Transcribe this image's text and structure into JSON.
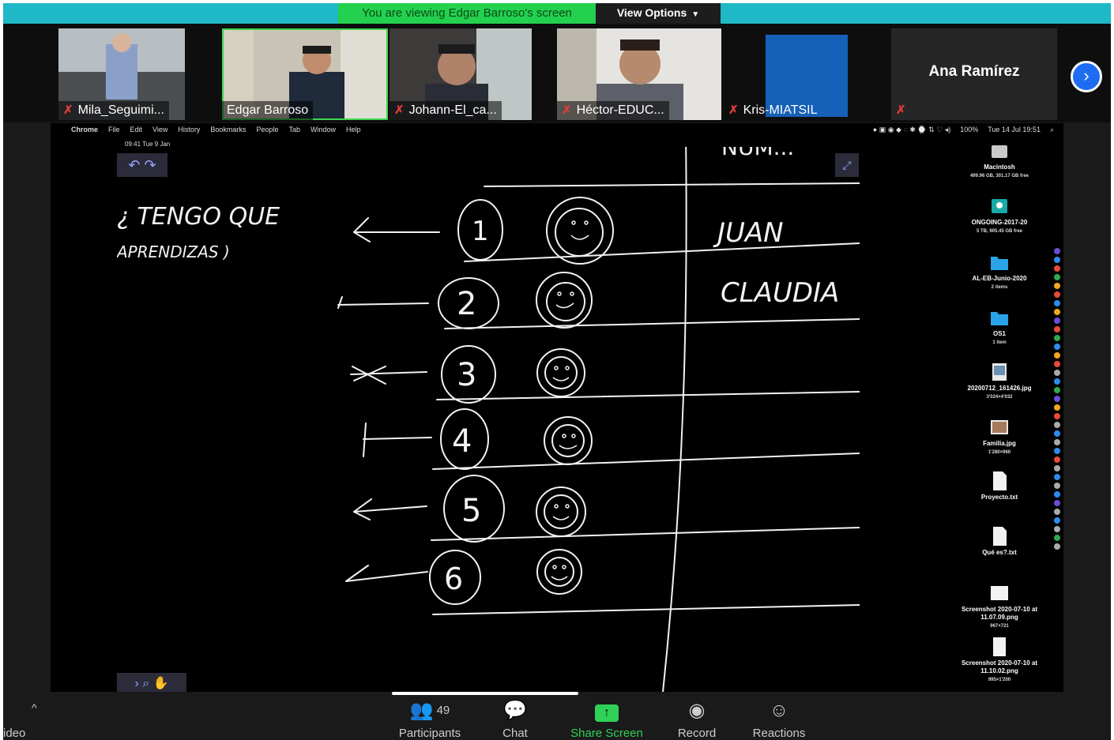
{
  "banner": {
    "viewing_text": "You are viewing Edgar Barroso's screen",
    "view_options_label": "View Options"
  },
  "participants": [
    {
      "name": "Mila_Seguimi...",
      "muted": true
    },
    {
      "name": "Edgar Barroso",
      "muted": false,
      "active_speaker": true
    },
    {
      "name": "Johann-El_ca...",
      "muted": true
    },
    {
      "name": "Héctor-EDUC...",
      "muted": true
    },
    {
      "name": "Kris-MIATSIL",
      "muted": true
    },
    {
      "name": "Ana Ramírez",
      "muted": true,
      "video": false
    }
  ],
  "shared_screen": {
    "menu": [
      "Chrome",
      "File",
      "Edit",
      "View",
      "History",
      "Bookmarks",
      "People",
      "Tab",
      "Window",
      "Help"
    ],
    "status_zoom": "100%",
    "clock": "Tue 14 Jul 19:51",
    "app_datetime": "09:41 Tue 9 Jan",
    "handwriting": {
      "question_line1": "¿ TENGO QUE",
      "question_line2": "APRENDIZAS )",
      "header_partial": "NUM...",
      "names": [
        "JUAN",
        "CLAUDIA"
      ],
      "numbers": [
        "1",
        "2",
        "3",
        "4",
        "5",
        "6"
      ]
    },
    "desktop_icons": [
      {
        "label": "Macintosh",
        "sub": "499.96 GB, 301.17 GB free",
        "kind": "drive"
      },
      {
        "label": "ONGOING-2017-20",
        "sub": "5 TB, 905.45 GB free",
        "kind": "external"
      },
      {
        "label": "AL-EB-Junio-2020",
        "sub": "2 items",
        "kind": "folder"
      },
      {
        "label": "OS1",
        "sub": "1 item",
        "kind": "folder"
      },
      {
        "label": "20200712_161426.jpg",
        "sub": "3'024×4'032",
        "kind": "image"
      },
      {
        "label": "Familia.jpg",
        "sub": "1'280×960",
        "kind": "image"
      },
      {
        "label": "Proyecto.txt",
        "sub": "",
        "kind": "doc"
      },
      {
        "label": "Qué es?.txt",
        "sub": "",
        "kind": "doc"
      },
      {
        "label": "Screenshot 2020-07-10 at 11.07.09.png",
        "sub": "967×721",
        "kind": "image"
      },
      {
        "label": "Screenshot 2020-07-10 at 11.10.02.png",
        "sub": "995×1'200",
        "kind": "image"
      }
    ]
  },
  "toolbar": {
    "video_label": "ideo",
    "participants_label": "Participants",
    "participants_count": "49",
    "chat_label": "Chat",
    "share_label": "Share Screen",
    "record_label": "Record",
    "reactions_label": "Reactions"
  },
  "colors": {
    "banner_teal": "#1fb8c6",
    "banner_green": "#23d14f",
    "share_green": "#2fd158",
    "next_blue": "#1e6cf2"
  }
}
